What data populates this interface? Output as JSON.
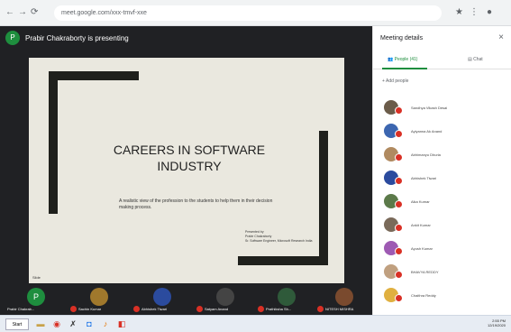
{
  "browser": {
    "url": "meet.google.com/xxx-tmvf-xxe"
  },
  "presenter": {
    "initial": "P",
    "text": "Prabir Chakraborty is presenting"
  },
  "slide": {
    "title_line1": "CAREERS IN SOFTWARE",
    "title_line2": "INDUSTRY",
    "subtitle": "A realistic view of the profession to the students to help them in their decision making process.",
    "presented_by": "Presented by",
    "presenter_name": "Prabir Chakraborty",
    "presenter_org": "Sr. Software Engineer, Microsoft Research India",
    "corner": "Slide"
  },
  "participants_bar": [
    {
      "name": "Prabir Chakrab...",
      "color": "#1e8e3e",
      "initial": "P"
    },
    {
      "name": "Sachin Kumar",
      "color": "#a0782c",
      "initial": ""
    },
    {
      "name": "Abhishek Tiwari",
      "color": "#2b4b9e",
      "initial": ""
    },
    {
      "name": "Satyam Anand",
      "color": "#444444",
      "initial": ""
    },
    {
      "name": "Prathiksha Sh...",
      "color": "#2f5a3a",
      "initial": ""
    },
    {
      "name": "NITESH MISHRA",
      "color": "#7a4a2e",
      "initial": ""
    }
  ],
  "sidebar": {
    "title": "Meeting details",
    "close": "×",
    "tab_people": "People (41)",
    "tab_chat": "Chat",
    "add_people": "Add people",
    "people": [
      {
        "name": "Sandhya Vikash Desai",
        "color": "#6b5c4a"
      },
      {
        "name": "Ayiyanna Ak Anand",
        "color": "#3c66b0"
      },
      {
        "name": "Abhimanyu Dhuria",
        "color": "#b08a60"
      },
      {
        "name": "Abhishek Tiwari",
        "color": "#2b4b9e"
      },
      {
        "name": "Alka Kumar",
        "color": "#5c7a4a"
      },
      {
        "name": "Ankit Kumar",
        "color": "#7a6a5a"
      },
      {
        "name": "Ayush Kumar",
        "color": "#9e5ab3"
      },
      {
        "name": "BHAVYA REDDY",
        "color": "#c0a080"
      },
      {
        "name": "Chaithra Reddy",
        "color": "#e0b040"
      }
    ]
  },
  "taskbar": {
    "start": "Start",
    "time": "2:55 PM",
    "date": "12/19/2020"
  }
}
